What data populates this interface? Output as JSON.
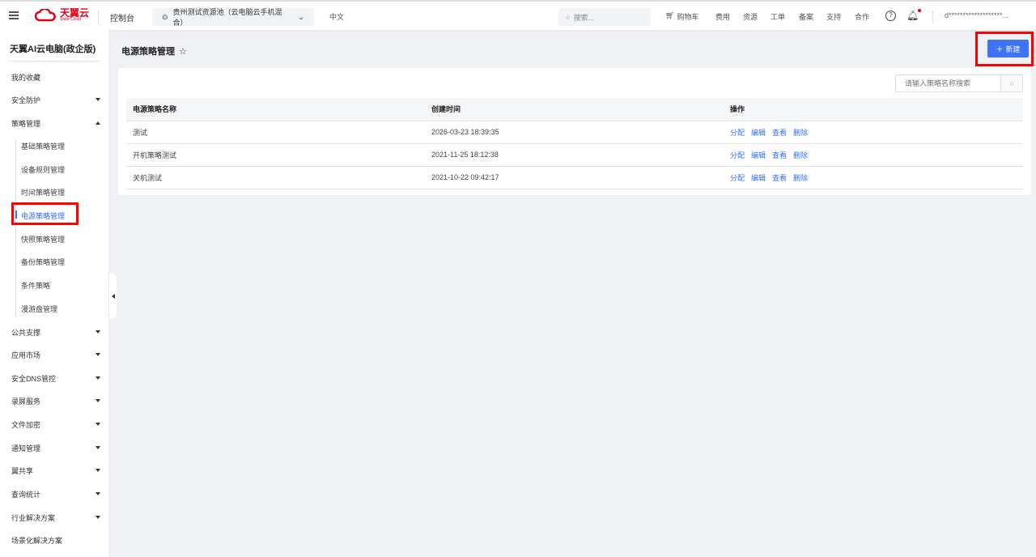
{
  "header": {
    "logo": "天翼云",
    "logo_sub": "State Cloud",
    "console": "控制台",
    "region": "贵州测试资源池（云电脑云手机混合）",
    "lang": "中文",
    "search_placeholder": "搜索...",
    "cart": "购物车",
    "nav": [
      "费用",
      "资源",
      "工单",
      "备案",
      "支持",
      "合作"
    ],
    "user": "d*******************..."
  },
  "sidebar": {
    "title": "天翼AI云电脑(政企版)",
    "items_top": [
      {
        "label": "我的收藏"
      },
      {
        "label": "安全防护"
      },
      {
        "label": "策略管理"
      }
    ],
    "sub": [
      "基础策略管理",
      "设备规则管理",
      "时间策略管理",
      "电源策略管理",
      "快照策略管理",
      "备份策略管理",
      "条件策略",
      "漫游盘管理"
    ],
    "items_bottom": [
      "公共支撑",
      "应用市场",
      "安全DNS管控",
      "录屏服务",
      "文件加密",
      "通知管理",
      "翼共享",
      "查询统计",
      "行业解决方案",
      "场景化解决方案"
    ]
  },
  "page": {
    "title": "电源策略管理",
    "new_button": "新建",
    "search_placeholder": "请输入策略名称搜索",
    "columns": [
      "电源策略名称",
      "创建时间",
      "操作"
    ],
    "rows": [
      {
        "name": "测试",
        "time": "2026-03-23 18:39:35"
      },
      {
        "name": "开机策略测试",
        "time": "2021-11-25 18:12:38"
      },
      {
        "name": "关机测试",
        "time": "2021-10-22 09:42:17"
      }
    ],
    "actions": [
      "分配",
      "编辑",
      "查看",
      "删除"
    ]
  },
  "colors": {
    "accent": "#3d73f5",
    "brand": "#e60012",
    "highlight": "#ff0000"
  }
}
